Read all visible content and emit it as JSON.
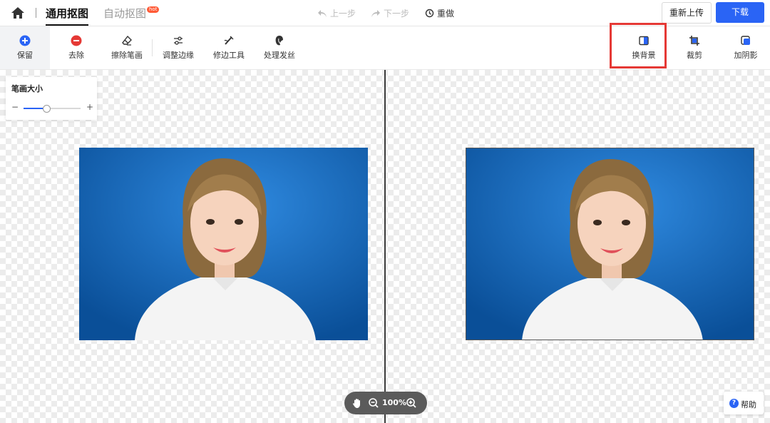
{
  "topbar": {
    "tabs": [
      {
        "label": "通用抠图",
        "active": true
      },
      {
        "label": "自动抠图",
        "active": false,
        "badge": "hot"
      }
    ],
    "undo_label": "上一步",
    "redo_label": "下一步",
    "reset_label": "重做",
    "reupload_label": "重新上传",
    "download_label": "下载"
  },
  "toolbar": {
    "tools": [
      {
        "label": "保留",
        "icon": "plus-circle-icon"
      },
      {
        "label": "去除",
        "icon": "minus-circle-icon"
      },
      {
        "label": "擦除笔画",
        "icon": "eraser-icon"
      },
      {
        "label": "调整边缘",
        "icon": "sliders-icon"
      },
      {
        "label": "修边工具",
        "icon": "trim-brush-icon"
      },
      {
        "label": "处理发丝",
        "icon": "hair-icon"
      },
      {
        "label": "换背景",
        "icon": "background-icon"
      },
      {
        "label": "裁剪",
        "icon": "crop-icon"
      },
      {
        "label": "加阴影",
        "icon": "shadow-icon"
      }
    ]
  },
  "brush_panel": {
    "title": "笔画大小",
    "minus": "−",
    "plus": "+",
    "value_fraction": 0.4
  },
  "zoom": {
    "percent": "100%"
  },
  "help": {
    "label": "帮助"
  },
  "colors": {
    "accent": "#2a64f5",
    "remove_red": "#e53935",
    "photo_bg": "#1565b8"
  }
}
